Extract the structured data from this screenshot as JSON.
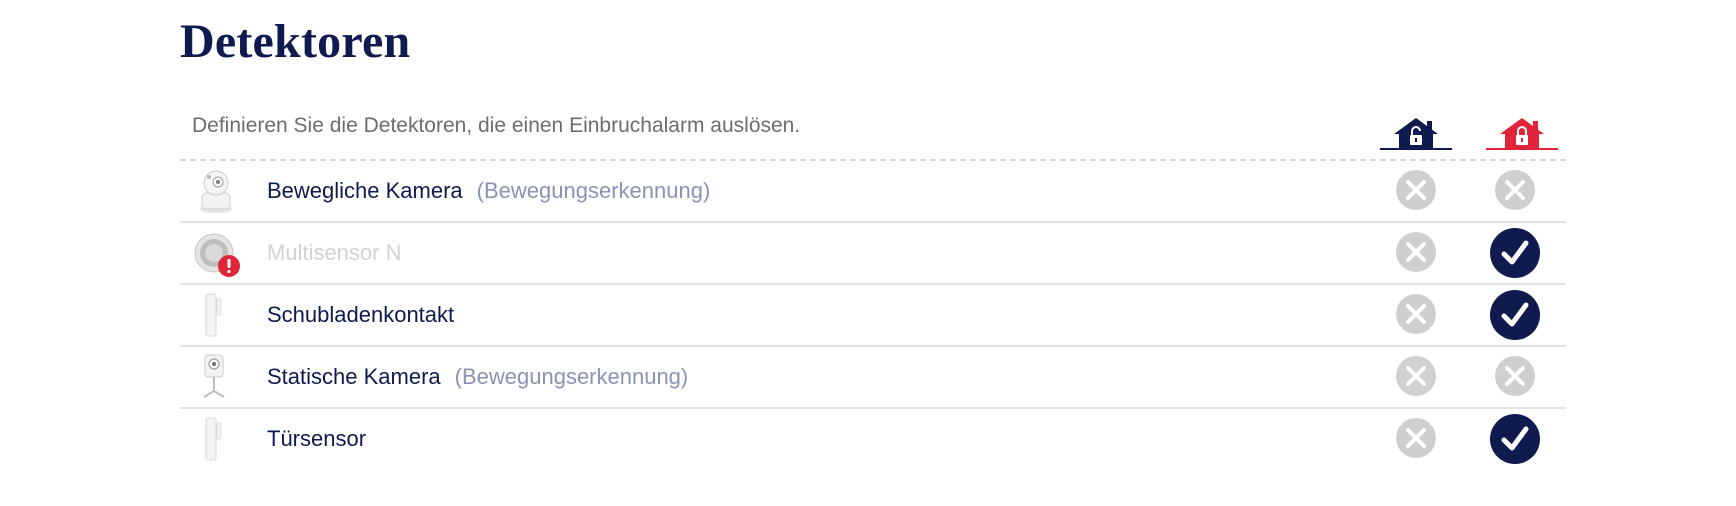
{
  "page": {
    "title": "Detektoren",
    "description": "Definieren Sie die Detektoren, die einen Einbruchalarm auslösen."
  },
  "columns": [
    {
      "mode": "disarmed",
      "icon": "house-unlocked-icon",
      "color": "#0f1a4e"
    },
    {
      "mode": "armed",
      "icon": "house-locked-icon",
      "color": "#e0243a"
    }
  ],
  "colors": {
    "navy": "#0f1a4e",
    "red": "#e0243a",
    "inactive_grey": "#cfcfcf",
    "subtitle": "#8a93b3"
  },
  "detectors": [
    {
      "name": "Bewegliche Kamera",
      "subtitle": "(Bewegungserkennung)",
      "icon": "pan-tilt-camera-icon",
      "warning": false,
      "disabled": false,
      "disarmed_active": false,
      "armed_active": false
    },
    {
      "name": "Multisensor N",
      "subtitle": "",
      "icon": "multisensor-icon",
      "warning": true,
      "disabled": true,
      "disarmed_active": false,
      "armed_active": true
    },
    {
      "name": "Schubladenkontakt",
      "subtitle": "",
      "icon": "contact-sensor-icon",
      "warning": false,
      "disabled": false,
      "disarmed_active": false,
      "armed_active": true
    },
    {
      "name": "Statische Kamera",
      "subtitle": "(Bewegungserkennung)",
      "icon": "static-camera-icon",
      "warning": false,
      "disabled": false,
      "disarmed_active": false,
      "armed_active": false
    },
    {
      "name": "Türsensor",
      "subtitle": "",
      "icon": "contact-sensor-icon",
      "warning": false,
      "disabled": false,
      "disarmed_active": false,
      "armed_active": true
    }
  ]
}
